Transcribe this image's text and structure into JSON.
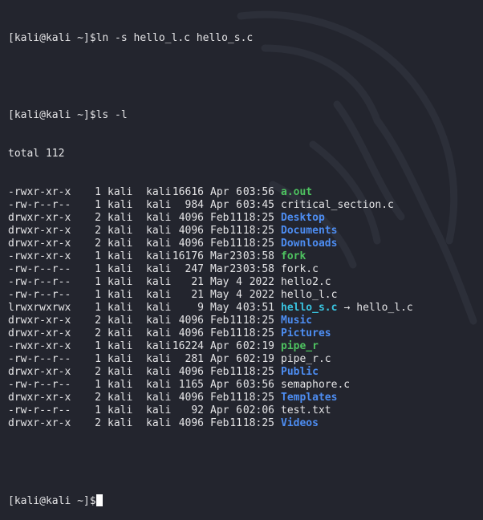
{
  "colors": {
    "background": "#23252e",
    "text": "#e4e4e6",
    "directory": "#4d8df2",
    "executable": "#4ec260",
    "symlink": "#39c4e0"
  },
  "terminal": {
    "line1": "[kali@kali ~]$ln -s hello_l.c hello_s.c",
    "line2": "[kali@kali ~]$ls -l",
    "total": "total 112",
    "prompt": "[kali@kali ~]$",
    "symlink_arrow": "→",
    "entries": [
      {
        "perm": "-rwxr-xr-x",
        "links": "1",
        "owner": "kali",
        "group": "kali",
        "size": "16616",
        "month": "Apr",
        "day": "6",
        "time": "03:56",
        "name": "a.out",
        "type": "exe",
        "target": ""
      },
      {
        "perm": "-rw-r--r--",
        "links": "1",
        "owner": "kali",
        "group": "kali",
        "size": "984",
        "month": "Apr",
        "day": "6",
        "time": "03:45",
        "name": "critical_section.c",
        "type": "file",
        "target": ""
      },
      {
        "perm": "drwxr-xr-x",
        "links": "2",
        "owner": "kali",
        "group": "kali",
        "size": "4096",
        "month": "Feb",
        "day": "11",
        "time": "18:25",
        "name": "Desktop",
        "type": "dir",
        "target": ""
      },
      {
        "perm": "drwxr-xr-x",
        "links": "2",
        "owner": "kali",
        "group": "kali",
        "size": "4096",
        "month": "Feb",
        "day": "11",
        "time": "18:25",
        "name": "Documents",
        "type": "dir",
        "target": ""
      },
      {
        "perm": "drwxr-xr-x",
        "links": "2",
        "owner": "kali",
        "group": "kali",
        "size": "4096",
        "month": "Feb",
        "day": "11",
        "time": "18:25",
        "name": "Downloads",
        "type": "dir",
        "target": ""
      },
      {
        "perm": "-rwxr-xr-x",
        "links": "1",
        "owner": "kali",
        "group": "kali",
        "size": "16176",
        "month": "Mar",
        "day": "23",
        "time": "03:58",
        "name": "fork",
        "type": "exe",
        "target": ""
      },
      {
        "perm": "-rw-r--r--",
        "links": "1",
        "owner": "kali",
        "group": "kali",
        "size": "247",
        "month": "Mar",
        "day": "23",
        "time": "03:58",
        "name": "fork.c",
        "type": "file",
        "target": ""
      },
      {
        "perm": "-rw-r--r--",
        "links": "1",
        "owner": "kali",
        "group": "kali",
        "size": "21",
        "month": "May",
        "day": "4",
        "time": "2022",
        "name": "hello2.c",
        "type": "file",
        "target": ""
      },
      {
        "perm": "-rw-r--r--",
        "links": "1",
        "owner": "kali",
        "group": "kali",
        "size": "21",
        "month": "May",
        "day": "4",
        "time": "2022",
        "name": "hello_l.c",
        "type": "file",
        "target": ""
      },
      {
        "perm": "lrwxrwxrwx",
        "links": "1",
        "owner": "kali",
        "group": "kali",
        "size": "9",
        "month": "May",
        "day": "4",
        "time": "03:51",
        "name": "hello_s.c",
        "type": "link",
        "target": "hello_l.c"
      },
      {
        "perm": "drwxr-xr-x",
        "links": "2",
        "owner": "kali",
        "group": "kali",
        "size": "4096",
        "month": "Feb",
        "day": "11",
        "time": "18:25",
        "name": "Music",
        "type": "dir",
        "target": ""
      },
      {
        "perm": "drwxr-xr-x",
        "links": "2",
        "owner": "kali",
        "group": "kali",
        "size": "4096",
        "month": "Feb",
        "day": "11",
        "time": "18:25",
        "name": "Pictures",
        "type": "dir",
        "target": ""
      },
      {
        "perm": "-rwxr-xr-x",
        "links": "1",
        "owner": "kali",
        "group": "kali",
        "size": "16224",
        "month": "Apr",
        "day": "6",
        "time": "02:19",
        "name": "pipe_r",
        "type": "exe",
        "target": ""
      },
      {
        "perm": "-rw-r--r--",
        "links": "1",
        "owner": "kali",
        "group": "kali",
        "size": "281",
        "month": "Apr",
        "day": "6",
        "time": "02:19",
        "name": "pipe_r.c",
        "type": "file",
        "target": ""
      },
      {
        "perm": "drwxr-xr-x",
        "links": "2",
        "owner": "kali",
        "group": "kali",
        "size": "4096",
        "month": "Feb",
        "day": "11",
        "time": "18:25",
        "name": "Public",
        "type": "dir",
        "target": ""
      },
      {
        "perm": "-rw-r--r--",
        "links": "1",
        "owner": "kali",
        "group": "kali",
        "size": "1165",
        "month": "Apr",
        "day": "6",
        "time": "03:56",
        "name": "semaphore.c",
        "type": "file",
        "target": ""
      },
      {
        "perm": "drwxr-xr-x",
        "links": "2",
        "owner": "kali",
        "group": "kali",
        "size": "4096",
        "month": "Feb",
        "day": "11",
        "time": "18:25",
        "name": "Templates",
        "type": "dir",
        "target": ""
      },
      {
        "perm": "-rw-r--r--",
        "links": "1",
        "owner": "kali",
        "group": "kali",
        "size": "92",
        "month": "Apr",
        "day": "6",
        "time": "02:06",
        "name": "test.txt",
        "type": "file",
        "target": ""
      },
      {
        "perm": "drwxr-xr-x",
        "links": "2",
        "owner": "kali",
        "group": "kali",
        "size": "4096",
        "month": "Feb",
        "day": "11",
        "time": "18:25",
        "name": "Videos",
        "type": "dir",
        "target": ""
      }
    ]
  }
}
